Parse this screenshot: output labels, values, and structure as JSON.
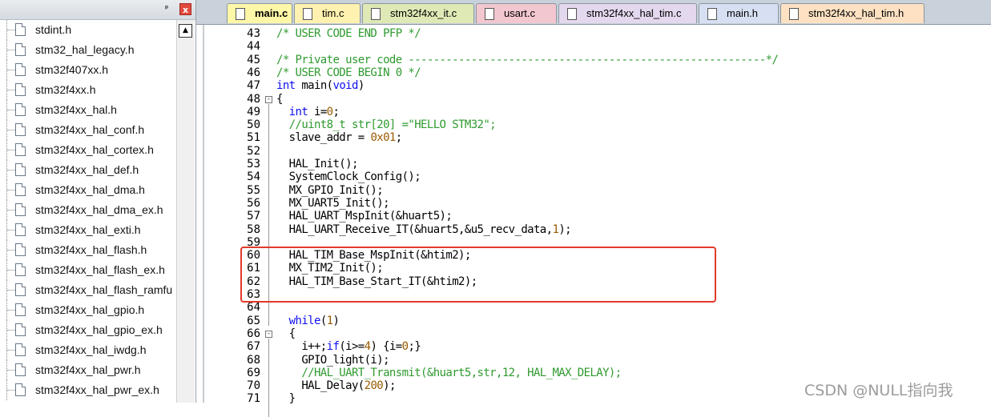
{
  "file_tree": {
    "pin_glyph": "ᵖ",
    "close_glyph": "x",
    "items": [
      "stdint.h",
      "stm32_hal_legacy.h",
      "stm32f407xx.h",
      "stm32f4xx.h",
      "stm32f4xx_hal.h",
      "stm32f4xx_hal_conf.h",
      "stm32f4xx_hal_cortex.h",
      "stm32f4xx_hal_def.h",
      "stm32f4xx_hal_dma.h",
      "stm32f4xx_hal_dma_ex.h",
      "stm32f4xx_hal_exti.h",
      "stm32f4xx_hal_flash.h",
      "stm32f4xx_hal_flash_ex.h",
      "stm32f4xx_hal_flash_ramfu",
      "stm32f4xx_hal_gpio.h",
      "stm32f4xx_hal_gpio_ex.h",
      "stm32f4xx_hal_iwdg.h",
      "stm32f4xx_hal_pwr.h",
      "stm32f4xx_hal_pwr_ex.h"
    ]
  },
  "tabs": [
    {
      "label": "main.c",
      "color": "#fff7a8",
      "active": true,
      "icon": "file-icon"
    },
    {
      "label": "tim.c",
      "color": "#fff2b0",
      "active": false,
      "icon": "file-icon"
    },
    {
      "label": "stm32f4xx_it.c",
      "color": "#dfe9b6",
      "active": false,
      "icon": "file-icon"
    },
    {
      "label": "usart.c",
      "color": "#f3c7cf",
      "active": false,
      "icon": "gear-file-icon"
    },
    {
      "label": "stm32f4xx_hal_tim.c",
      "color": "#e4d8ee",
      "active": false,
      "icon": "file-icon"
    },
    {
      "label": "main.h",
      "color": "#d7e0f3",
      "active": false,
      "icon": "file-icon"
    },
    {
      "label": "stm32f4xx_hal_tim.h",
      "color": "#fde1c2",
      "active": false,
      "icon": "file-icon"
    }
  ],
  "code_lines": [
    {
      "n": "43",
      "t": "/* USER CODE END PFP */"
    },
    {
      "n": "44",
      "t": ""
    },
    {
      "n": "45",
      "t": "/* Private user code ---------------------------------------------------------*/"
    },
    {
      "n": "46",
      "t": "/* USER CODE BEGIN 0 */"
    },
    {
      "n": "47",
      "t": "int main(void)"
    },
    {
      "n": "48",
      "t": "{"
    },
    {
      "n": "49",
      "t": "  int i=0;"
    },
    {
      "n": "50",
      "t": "  //uint8_t str[20] =\"HELLO STM32\";"
    },
    {
      "n": "51",
      "t": "  slave_addr = 0x01;"
    },
    {
      "n": "52",
      "t": ""
    },
    {
      "n": "53",
      "t": "  HAL_Init();"
    },
    {
      "n": "54",
      "t": "  SystemClock_Config();"
    },
    {
      "n": "55",
      "t": "  MX_GPIO_Init();"
    },
    {
      "n": "56",
      "t": "  MX_UART5_Init();"
    },
    {
      "n": "57",
      "t": "  HAL_UART_MspInit(&huart5);"
    },
    {
      "n": "58",
      "t": "  HAL_UART_Receive_IT(&huart5,&u5_recv_data,1);"
    },
    {
      "n": "59",
      "t": ""
    },
    {
      "n": "60",
      "t": "  HAL_TIM_Base_MspInit(&htim2);"
    },
    {
      "n": "61",
      "t": "  MX_TIM2_Init();"
    },
    {
      "n": "62",
      "t": "  HAL_TIM_Base_Start_IT(&htim2);"
    },
    {
      "n": "63",
      "t": ""
    },
    {
      "n": "64",
      "t": ""
    },
    {
      "n": "65",
      "t": "  while(1)"
    },
    {
      "n": "66",
      "t": "  {"
    },
    {
      "n": "67",
      "t": "    i++;if(i>=4) {i=0;}"
    },
    {
      "n": "68",
      "t": "    GPIO_light(i);"
    },
    {
      "n": "69",
      "t": "    //HAL_UART_Transmit(&huart5,str,12, HAL_MAX_DELAY);"
    },
    {
      "n": "70",
      "t": "    HAL_Delay(200);"
    },
    {
      "n": "71",
      "t": "  }"
    }
  ],
  "watermark": "CSDN @NULL指向我",
  "colors": {
    "highlight_box": "#e23a2a",
    "comment": "#2f9a2f",
    "keyword": "#1010ee"
  }
}
